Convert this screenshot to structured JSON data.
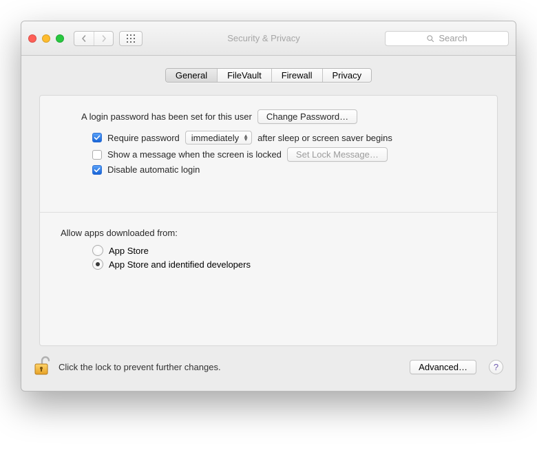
{
  "window": {
    "title": "Security & Privacy",
    "search_placeholder": "Search"
  },
  "tabs": [
    {
      "label": "General",
      "active": true
    },
    {
      "label": "FileVault",
      "active": false
    },
    {
      "label": "Firewall",
      "active": false
    },
    {
      "label": "Privacy",
      "active": false
    }
  ],
  "general": {
    "login_password_text": "A login password has been set for this user",
    "change_password_label": "Change Password…",
    "require_password_label": "Require password",
    "require_password_delay": "immediately",
    "require_password_suffix": "after sleep or screen saver begins",
    "require_password_checked": true,
    "show_message_label": "Show a message when the screen is locked",
    "show_message_checked": false,
    "set_lock_message_label": "Set Lock Message…",
    "disable_auto_login_label": "Disable automatic login",
    "disable_auto_login_checked": true
  },
  "gatekeeper": {
    "section_label": "Allow apps downloaded from:",
    "options": [
      {
        "label": "App Store",
        "selected": false
      },
      {
        "label": "App Store and identified developers",
        "selected": true
      }
    ]
  },
  "footer": {
    "lock_text": "Click the lock to prevent further changes.",
    "advanced_label": "Advanced…",
    "help_label": "?"
  }
}
